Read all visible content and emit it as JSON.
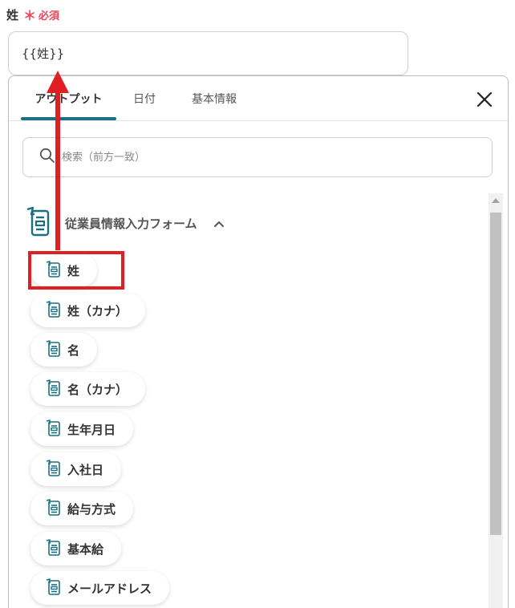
{
  "field": {
    "label": "姓",
    "required_mark": "＊",
    "required_text": "必須",
    "value": "{{姓}}"
  },
  "tabs": [
    {
      "label": "アウトプット",
      "active": true
    },
    {
      "label": "日付",
      "active": false
    },
    {
      "label": "基本情報",
      "active": false
    }
  ],
  "search": {
    "placeholder": "検索（前方一致）",
    "icon": "search-icon"
  },
  "group": {
    "title": "従業員情報入力フォーム",
    "icon": "form-output-icon",
    "expanded": true
  },
  "items": [
    {
      "label": "姓"
    },
    {
      "label": "姓（カナ）"
    },
    {
      "label": "名"
    },
    {
      "label": "名（カナ）"
    },
    {
      "label": "生年月日"
    },
    {
      "label": "入社日"
    },
    {
      "label": "給与方式"
    },
    {
      "label": "基本給"
    },
    {
      "label": "メールアドレス"
    }
  ],
  "colors": {
    "accent": "#1a6f80",
    "required": "#e8475a",
    "annotation": "#e01f25"
  }
}
